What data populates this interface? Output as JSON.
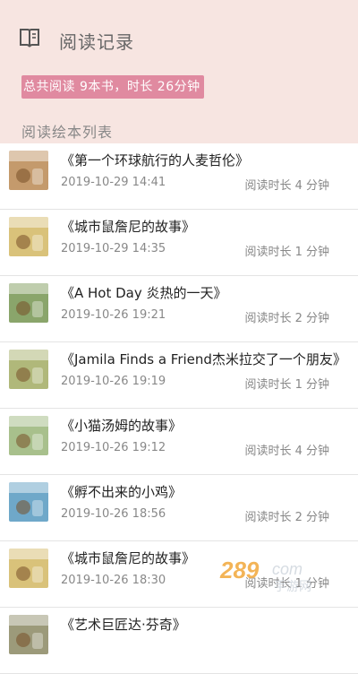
{
  "header": {
    "title": "阅读记录",
    "icon": "open-book-icon"
  },
  "summary": {
    "text": "总共阅读 9本书，时长 26分钟"
  },
  "section": {
    "title": "阅读绘本列表"
  },
  "items": [
    {
      "name": "《第一个环球航行的人麦哲伦》",
      "date": "2019-10-29 14:41",
      "duration": "阅读时长 4 分钟",
      "cover": "#c49a6c"
    },
    {
      "name": "《城市鼠詹尼的故事》",
      "date": "2019-10-29 14:35",
      "duration": "阅读时长 1 分钟",
      "cover": "#d9c27a"
    },
    {
      "name": "《A Hot Day 炎热的一天》",
      "date": "2019-10-26 19:21",
      "duration": "阅读时长 2 分钟",
      "cover": "#8aa56b"
    },
    {
      "name": "《Jamila Finds a Friend杰米拉交了一个朋友》",
      "date": "2019-10-26 19:19",
      "duration": "阅读时长 1 分钟",
      "cover": "#b0b87a"
    },
    {
      "name": "《小猫汤姆的故事》",
      "date": "2019-10-26 19:12",
      "duration": "阅读时长 4 分钟",
      "cover": "#a8c08c"
    },
    {
      "name": "《孵不出来的小鸡》",
      "date": "2019-10-26 18:56",
      "duration": "阅读时长 2 分钟",
      "cover": "#6fa8c9"
    },
    {
      "name": "《城市鼠詹尼的故事》",
      "date": "2019-10-26 18:30",
      "duration": "阅读时长 1 分钟",
      "cover": "#d9c27a"
    },
    {
      "name": "《艺术巨匠达·芬奇》",
      "date": "",
      "duration": "",
      "cover": "#9c9a7a"
    }
  ],
  "watermark": {
    "text1": "289",
    "text2": "com",
    "text3": "手游网"
  }
}
